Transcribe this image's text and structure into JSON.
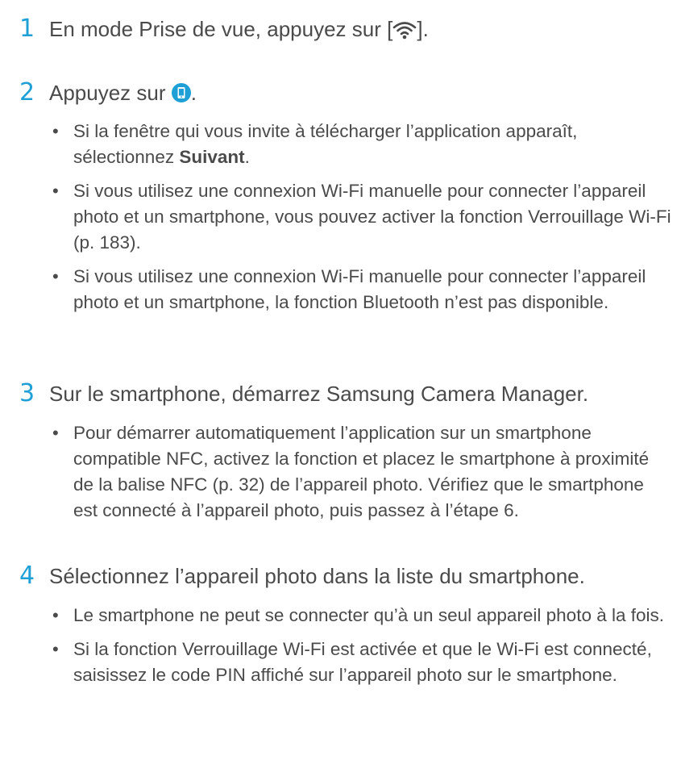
{
  "steps": [
    {
      "number": "1",
      "text_before": "En mode Prise de vue, appuyez sur [",
      "icon": "wifi-icon",
      "text_after": "]."
    },
    {
      "number": "2",
      "text_before": "Appuyez sur ",
      "icon": "smartphone-icon",
      "icon_color": "#1e9fd6",
      "text_after": ".",
      "bullets": [
        {
          "text_before": "Si la fenêtre qui vous invite à télécharger l’application apparaît, sélectionnez ",
          "bold": "Suivant",
          "text_after": "."
        },
        {
          "text": "Si vous utilisez une connexion Wi-Fi manuelle pour connecter l’appareil photo et un smartphone, vous pouvez activer la fonction Verrouillage Wi-Fi (p. 183)."
        },
        {
          "text": "Si vous utilisez une connexion Wi-Fi manuelle pour connecter l’appareil photo et un smartphone, la fonction Bluetooth n’est pas disponible."
        }
      ]
    },
    {
      "number": "3",
      "text": "Sur le smartphone, démarrez Samsung Camera Manager.",
      "bullets": [
        {
          "text": "Pour démarrer automatiquement l’application sur un smartphone compatible NFC, activez la fonction et placez le smartphone à proximité de la balise NFC (p. 32) de l’appareil photo. Vérifiez que le smartphone est connecté à l’appareil photo, puis passez à l’étape 6."
        }
      ]
    },
    {
      "number": "4",
      "text": "Sélectionnez l’appareil photo dans la liste du smartphone.",
      "bullets": [
        {
          "text": "Le smartphone ne peut se connecter qu’à un seul appareil photo à la fois."
        },
        {
          "text": "Si la fonction Verrouillage Wi-Fi est activée et que le Wi-Fi est connecté, saisissez le code PIN affiché sur l’appareil photo sur le smartphone."
        }
      ]
    }
  ],
  "bullet_glyph": "•",
  "accent_color": "#1e9fd6"
}
